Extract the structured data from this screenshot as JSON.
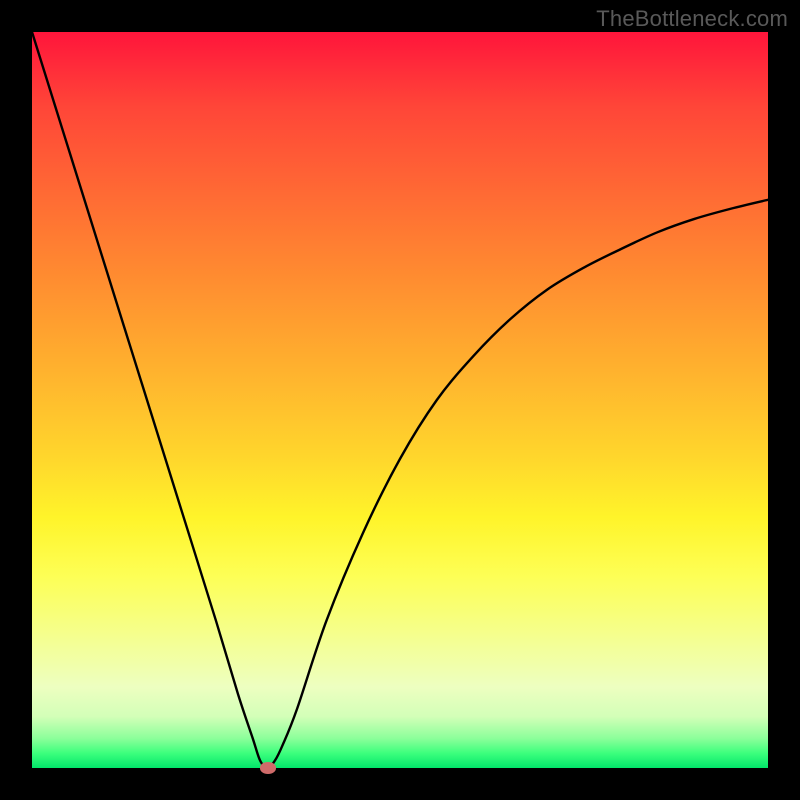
{
  "watermark": "TheBottleneck.com",
  "chart_data": {
    "type": "line",
    "title": "",
    "xlabel": "",
    "ylabel": "",
    "xlim": [
      0,
      100
    ],
    "ylim": [
      0,
      100
    ],
    "grid": false,
    "legend": false,
    "series": [
      {
        "name": "bottleneck-curve",
        "x": [
          0,
          5,
          10,
          15,
          20,
          25,
          28,
          30,
          31,
          32,
          33,
          34,
          36,
          40,
          45,
          50,
          55,
          60,
          65,
          70,
          75,
          80,
          85,
          90,
          95,
          100
        ],
        "y": [
          100,
          84,
          68,
          52,
          36,
          20,
          10,
          4,
          1,
          0,
          1,
          3,
          8,
          20,
          32,
          42,
          50,
          56,
          61,
          65,
          68,
          70.5,
          72.8,
          74.6,
          76,
          77.2
        ]
      }
    ],
    "marker": {
      "x": 32,
      "y": 0,
      "radius_px": 8,
      "color": "#cf6b6a"
    },
    "gradient_stops": [
      {
        "pos": 0.0,
        "color": "#ff153b"
      },
      {
        "pos": 0.5,
        "color": "#ffc82d"
      },
      {
        "pos": 0.8,
        "color": "#f5ff8e"
      },
      {
        "pos": 1.0,
        "color": "#02e56a"
      }
    ]
  }
}
